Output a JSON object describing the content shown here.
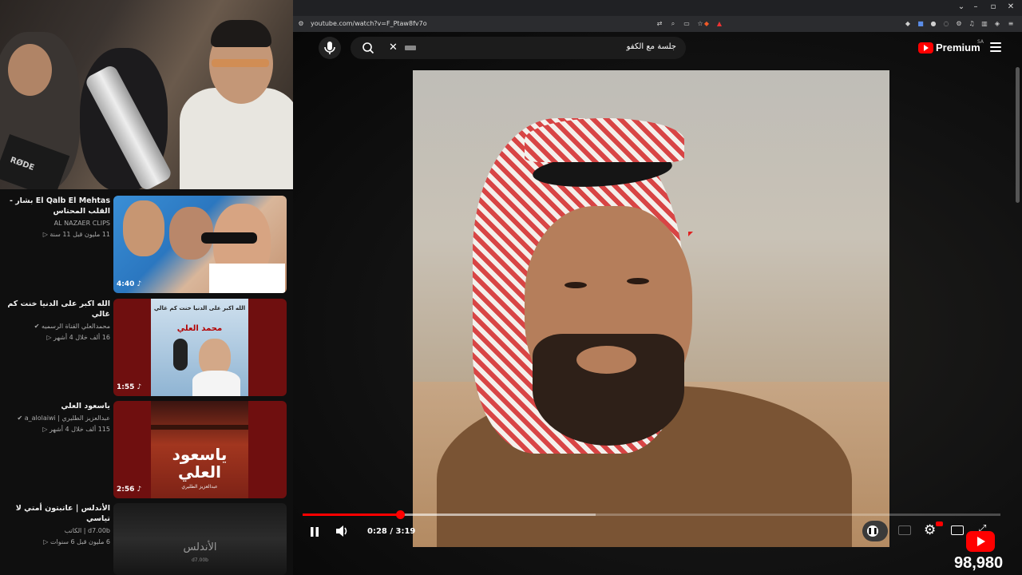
{
  "webcam": {
    "mic_brand": "RØDE"
  },
  "recommendations": [
    {
      "title": "El Qalb El Mehtas بشار - القلب المحتاس",
      "channel": "AL NAZAER CLIPS",
      "meta": "11 مليون  قبل 11 سنة",
      "duration": "4:40"
    },
    {
      "title": "الله اكبر على الدنيا خنت كم غالي",
      "channel": "محمدالعلي القناة الرسميه",
      "meta": "16 ألف  خلال 4 أشهر",
      "duration": "1:55",
      "thumb_text": "الله اكبر على الدنيا خنت كم غالي",
      "thumb_name": "محمد العلي"
    },
    {
      "title": "ياسعود العلي",
      "channel": "عبدالعزيز الطليري | a_alolaiwi",
      "meta": "115 ألف  خلال 4 أشهر",
      "duration": "2:56",
      "thumb_text": "ياسعود العلي",
      "thumb_sub": "عبدالعزيز الطليري"
    },
    {
      "title": "الأندلس | عاتبتون أمتي لا تياسي",
      "channel": "d7.00b | الكاتب",
      "meta": "6 مليون  قبل 6 سنوات",
      "duration": "",
      "thumb_text": "الأندلس",
      "thumb_sub": "d7.00b"
    }
  ],
  "browser": {
    "url": "youtube.com/watch?v=F_Ptaw8fv7o"
  },
  "youtube": {
    "search_value": "جلسة مع الكفو",
    "logo_text": "Premium",
    "region": "SA"
  },
  "player": {
    "current_time": "0:28",
    "duration": "3:19",
    "time_display": "0:28 / 3:19",
    "progress_fraction": 0.14,
    "buffered_fraction": 0.42
  },
  "overlay": {
    "counter": "98,980"
  },
  "colors": {
    "accent": "#ff0000",
    "bg": "#0f0f0f"
  }
}
